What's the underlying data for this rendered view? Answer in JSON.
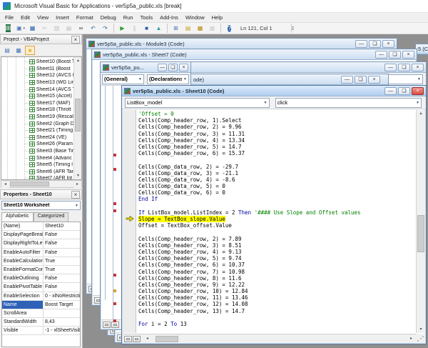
{
  "window": {
    "title": "Microsoft Visual Basic for Applications - ver5p5a_public.xls [break]"
  },
  "menu": {
    "items": [
      "File",
      "Edit",
      "View",
      "Insert",
      "Format",
      "Debug",
      "Run",
      "Tools",
      "Add-Ins",
      "Window",
      "Help"
    ]
  },
  "toolbar": {
    "position_indicator": "Ln 121, Col 1",
    "icons": [
      {
        "name": "view-excel-icon",
        "glyph": "⊞",
        "fg": "#ffffff",
        "bg": "#217346"
      },
      {
        "name": "insert-userform-icon",
        "glyph": "▣",
        "fg": "#4a76b8",
        "caret": true
      },
      {
        "name": "save-icon",
        "glyph": "▦",
        "fg": "#2a5caa"
      },
      {
        "name": "cut-icon",
        "glyph": "✂",
        "fg": "#707070",
        "disabled": true
      },
      {
        "name": "copy-icon",
        "glyph": "▥",
        "fg": "#707070",
        "disabled": true
      },
      {
        "name": "paste-icon",
        "glyph": "▤",
        "fg": "#707070",
        "disabled": true
      },
      {
        "name": "find-icon",
        "glyph": "∞",
        "fg": "#3a3a3a"
      },
      {
        "name": "undo-icon",
        "glyph": "↶",
        "fg": "#3a6ea5"
      },
      {
        "name": "redo-icon",
        "glyph": "↷",
        "fg": "#3a6ea5"
      },
      {
        "sep": true
      },
      {
        "name": "run-icon",
        "glyph": "▶",
        "fg": "#2e9a2e"
      },
      {
        "name": "break-icon",
        "glyph": "∥",
        "fg": "#707070",
        "disabled": true
      },
      {
        "name": "reset-icon",
        "glyph": "■",
        "fg": "#2a5caa"
      },
      {
        "name": "design-mode-icon",
        "glyph": "▲",
        "fg": "#2aa0a0"
      },
      {
        "sep": true
      },
      {
        "name": "project-explorer-icon",
        "glyph": "⊞",
        "fg": "#4a76b8"
      },
      {
        "name": "properties-window-icon",
        "glyph": "▤",
        "fg": "#c9a227"
      },
      {
        "name": "object-browser-icon",
        "glyph": "▦",
        "fg": "#b8860b"
      },
      {
        "name": "toolbox-icon",
        "glyph": "▩",
        "fg": "#9a9a9a",
        "disabled": true
      },
      {
        "sep": true
      },
      {
        "name": "help-icon",
        "glyph": "?",
        "fg": "#ffffff",
        "bg": "#2a5caa",
        "round": true
      }
    ]
  },
  "project_panel": {
    "title": "Project - VBAProject",
    "tools": [
      {
        "name": "view-code-icon",
        "glyph": "▤",
        "fg": "#4a76b8"
      },
      {
        "name": "view-object-icon",
        "glyph": "▦",
        "fg": "#4a76b8"
      },
      {
        "name": "toggle-folders-icon",
        "glyph": "■",
        "fg": "#e8b84b",
        "active": true
      }
    ],
    "tree_items": [
      "Sheet10 (Boost T",
      "Sheet11 (Boost ",
      "Sheet12 (AVCS I",
      "Sheet13 (WG Lin",
      "Sheet14 (AVCS T",
      "Sheet15 (Accel)",
      "Sheet17 (MAF)",
      "Sheet18 (Thrott",
      "Sheet19 (Rescal",
      "Sheet2 (Graph D",
      "Sheet21 (Timing",
      "Sheet24 (VE)",
      "Sheet26 (Param",
      "Sheet3 (Base Tir",
      "Sheet4 (Advanc",
      "Sheet5 (Timing I",
      "Sheet6 (AFR Tar",
      "Sheet7 (AFR Int"
    ]
  },
  "properties_panel": {
    "title": "Properties - Sheet10",
    "object_selector": "Sheet10 Worksheet",
    "tabs": [
      "Alphabetic",
      "Categorized"
    ],
    "active_tab": "Alphabetic",
    "rows": [
      {
        "label": "(Name)",
        "value": "Sheet10"
      },
      {
        "label": "DisplayPageBreak",
        "value": "False"
      },
      {
        "label": "DisplayRightToLef",
        "value": "False"
      },
      {
        "label": "EnableAutoFilter",
        "value": "False"
      },
      {
        "label": "EnableCalculation",
        "value": "True"
      },
      {
        "label": "EnableFormatCon",
        "value": "True"
      },
      {
        "label": "EnableOutlining",
        "value": "False"
      },
      {
        "label": "EnablePivotTable",
        "value": "False"
      },
      {
        "label": "EnableSelection",
        "value": "0 - xlNoRestricti"
      },
      {
        "label": "Name",
        "value": "Boost Target",
        "selected": true
      },
      {
        "label": "ScrollArea",
        "value": ""
      },
      {
        "label": "StandardWidth",
        "value": "8,43"
      },
      {
        "label": "Visible",
        "value": "-1 - xlSheetVisib"
      }
    ]
  },
  "mdi": {
    "module3_window": {
      "title": "ver5p5a_public.xls - Module3 (Code)"
    },
    "sheet7_window": {
      "title": "ver5p5a_public.xls - Sheet7 (Code)"
    },
    "edge_window": {
      "title_fragment": "5 (C"
    },
    "window5": {
      "title_fragment": "ode)"
    },
    "small_window": {
      "title": "ver5p5a_pu...",
      "object_combo": "(General)",
      "procedure_combo": "(Declarations)"
    }
  },
  "code_window": {
    "title": "ver5p5a_public.xls - Sheet10 (Code)",
    "object_combo": "ListBox_model",
    "procedure_combo": "click",
    "highlight_line": 17,
    "code_lines": [
      "'Offset = 0",
      "Cells(Comp_header_row, 1).Select",
      "Cells(Comp_header_row, 2) = 9.96",
      "Cells(Comp_header_row, 3) = 11.31",
      "Cells(Comp_header_row, 4) = 13.34",
      "Cells(Comp_header_row, 5) = 14.7",
      "Cells(Comp_header_row, 6) = 15.37",
      "",
      "Cells(Comp_data_row, 2) = -29.7",
      "Cells(Comp_data_row, 3) = -21.1",
      "Cells(Comp_data_row, 4) = -8.6",
      "Cells(Comp_data_row, 5) = 0",
      "Cells(Comp_data_row, 6) = 0",
      "End If",
      "",
      "If ListBox_model.ListIndex = 2 Then '#### Use Slope and Offset values",
      "Slope = TextBox_slope.Value",
      "Offset = TextBox_offset.Value",
      "",
      "Cells(Comp_header_row, 2) = 7.89",
      "Cells(Comp_header_row, 3) = 8.51",
      "Cells(Comp_header_row, 4) = 9.13",
      "Cells(Comp_header_row, 5) = 9.74",
      "Cells(Comp_header_row, 6) = 10.37",
      "Cells(Comp_header_row, 7) = 10.98",
      "Cells(Comp_header_row, 8) = 11.6",
      "Cells(Comp_header_row, 9) = 12.22",
      "Cells(Comp_header_row, 10) = 12.84",
      "Cells(Comp_header_row, 11) = 13.46",
      "Cells(Comp_header_row, 12) = 14.08",
      "Cells(Comp_header_row, 13) = 14.7",
      "",
      "For i = 2 To 13"
    ]
  }
}
